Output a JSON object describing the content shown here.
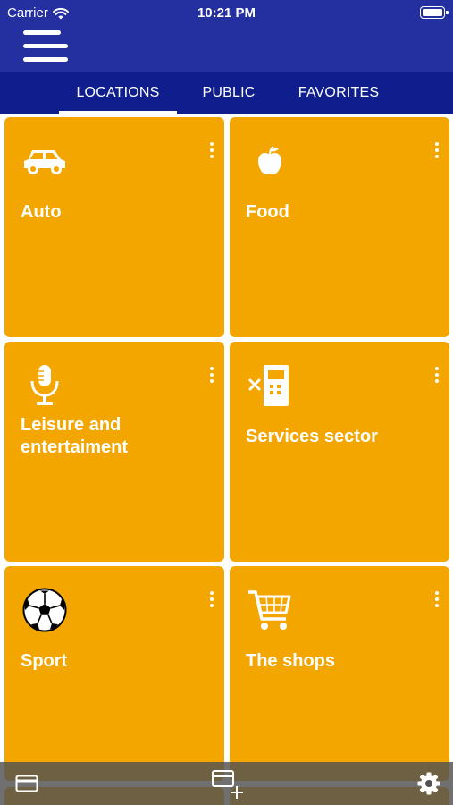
{
  "status_bar": {
    "carrier": "Carrier",
    "time": "10:21 PM"
  },
  "header": {
    "menu_icon": "hamburger-menu-icon"
  },
  "tabs": [
    {
      "label": "LOCATIONS",
      "active": true
    },
    {
      "label": "PUBLIC",
      "active": false
    },
    {
      "label": "FAVORITES",
      "active": false
    }
  ],
  "categories": [
    {
      "label": "Auto",
      "icon": "car-icon"
    },
    {
      "label": "Food",
      "icon": "apple-icon"
    },
    {
      "label": "Leisure and entertaiment",
      "icon": "microphone-icon"
    },
    {
      "label": "Services sector",
      "icon": "service-terminal-icon"
    },
    {
      "label": "Sport",
      "icon": "soccer-ball-icon"
    },
    {
      "label": "The shops",
      "icon": "shopping-cart-icon"
    }
  ],
  "bottom_bar": {
    "left_icon": "card-icon",
    "center_icon": "add-card-icon",
    "right_icon": "settings-gear-icon"
  },
  "colors": {
    "header": "#2430a0",
    "tab_bar": "#0f1e8c",
    "tile": "#f4a600",
    "text": "#ffffff"
  }
}
